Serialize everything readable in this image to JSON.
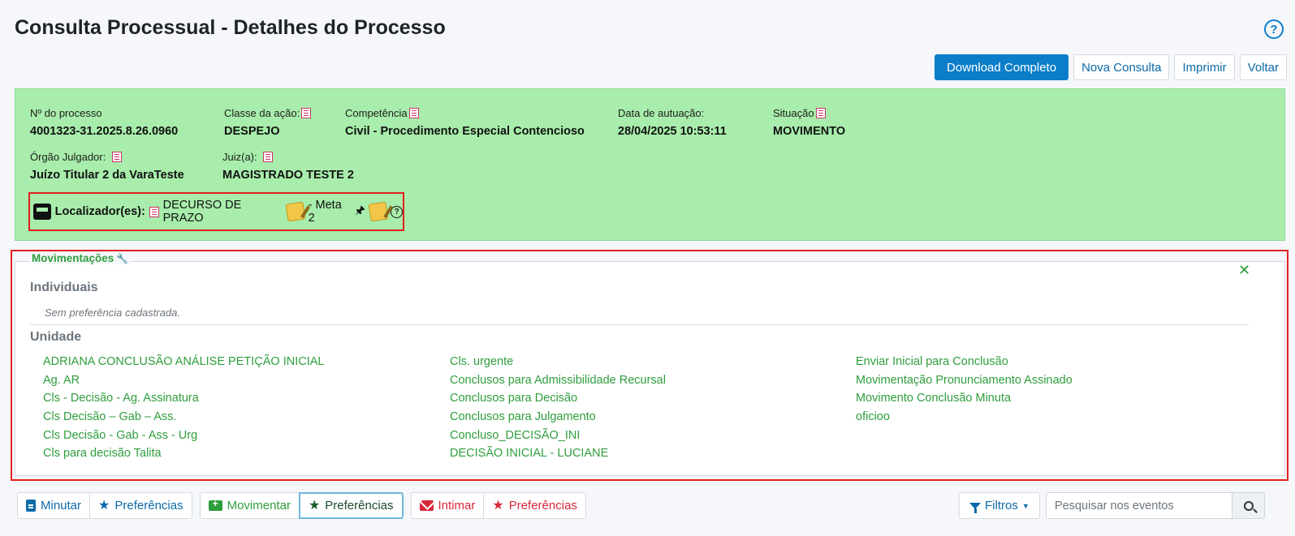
{
  "header": {
    "title": "Consulta Processual - Detalhes do Processo",
    "help_glyph": "?"
  },
  "actions": {
    "download": "Download Completo",
    "nova_consulta": "Nova Consulta",
    "imprimir": "Imprimir",
    "voltar": "Voltar"
  },
  "processo": {
    "numero": {
      "label": "Nº do processo",
      "value": "4001323-31.2025.8.26.0960"
    },
    "classe": {
      "label": "Classe da ação:",
      "value": "DESPEJO"
    },
    "competencia": {
      "label": "Competência",
      "value": "Civil - Procedimento Especial Contencioso"
    },
    "data_autuacao": {
      "label": "Data de autuação:",
      "value": "28/04/2025 10:53:11"
    },
    "situacao": {
      "label": "Situação",
      "value": "MOVIMENTO"
    },
    "orgao": {
      "label": "Órgão Julgador:",
      "value": "Juízo Titular 2 da VaraTeste"
    },
    "juiz": {
      "label": "Juiz(a):",
      "value": "MAGISTRADO TESTE 2"
    }
  },
  "localizador": {
    "label": "Localizador(es):",
    "item1": "DECURSO DE PRAZO",
    "item2": "- Meta 2",
    "pin": "🖈",
    "help": "?"
  },
  "movimentacoes": {
    "legend": "Movimentações",
    "close": "✕",
    "individuais_title": "Individuais",
    "individuais_empty": "Sem preferência cadastrada.",
    "unidade_title": "Unidade",
    "col1": [
      "ADRIANA CONCLUSÃO ANÁLISE PETIÇÃO INICIAL",
      "Ag. AR",
      "Cls - Decisão - Ag. Assinatura",
      "Cls Decisão – Gab – Ass.",
      "Cls Decisão - Gab - Ass - Urg",
      "Cls para decisão Talita"
    ],
    "col2": [
      "Cls. urgente",
      "Conclusos para Admissibilidade Recursal",
      "Conclusos para Decisão",
      "Conclusos para Julgamento",
      "Concluso_DECISÃO_INI",
      "DECISÃO INICIAL - LUCIANE"
    ],
    "col3": [
      "Enviar Inicial para Conclusão",
      "Movimentação Pronunciamento Assinado",
      "Movimento Conclusão Minuta",
      "oficioo"
    ]
  },
  "bottombar": {
    "minutar": "Minutar",
    "pref1": "Preferências",
    "movimentar": "Movimentar",
    "pref2": "Preferências",
    "intimar": "Intimar",
    "pref3": "Preferências",
    "filtros": "Filtros",
    "search_placeholder": "Pesquisar nos eventos"
  },
  "colors": {
    "panel_green": "#a8edab",
    "link_green": "#2e9e3c",
    "primary_blue": "#0c7ec9",
    "highlight_red": "#e0201e"
  }
}
